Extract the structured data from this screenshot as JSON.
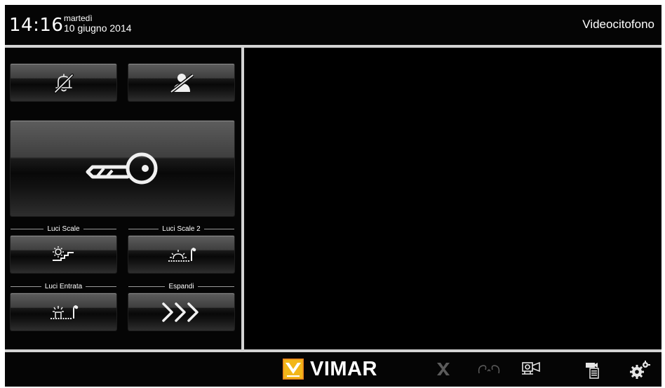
{
  "header": {
    "time": "14:16",
    "weekday": "martedì",
    "date": "10 giugno 2014",
    "title": "Videocitofono"
  },
  "controls": {
    "mute_ringer_icon": "bell-off-icon",
    "privacy_icon": "user-off-icon",
    "door_open_icon": "key-icon",
    "groups": [
      {
        "label": "Luci Scale",
        "icon": "stair-light-icon"
      },
      {
        "label": "Luci Scale 2",
        "icon": "garden-light-icon"
      },
      {
        "label": "Luci Entrata",
        "icon": "entrance-light-icon"
      },
      {
        "label": "Espandi",
        "icon": "chevrons-right-icon"
      }
    ]
  },
  "footer": {
    "brand": "VIMAR",
    "icons": [
      "call-transfer-icon",
      "intercom-icon",
      "camera-icon",
      "video-intercom-icon",
      "settings-icon"
    ]
  },
  "colors": {
    "background": "#050505",
    "divider": "#d4d4d4",
    "brand_yellow": "#f2b619",
    "brand_orange": "#e8801c",
    "icon_disabled": "#5b5b5b",
    "icon_active": "#e6e6e6"
  }
}
